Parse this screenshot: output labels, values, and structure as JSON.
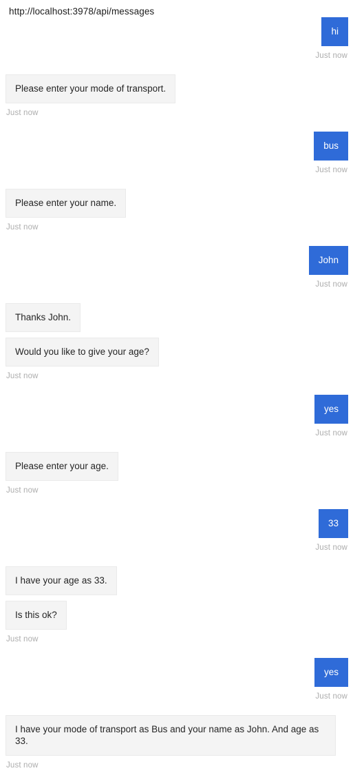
{
  "page": {
    "background_color": "#ffffff",
    "endpoint_url": "http://localhost:3978/api/messages"
  },
  "colors": {
    "user_bubble": "#2f6bd8",
    "user_text": "#ffffff",
    "bot_bubble": "#f4f4f4",
    "bot_border": "#eaeaea",
    "bot_text": "#252525",
    "timestamp": "#adadad"
  },
  "conversation": {
    "groups": [
      {
        "from": "user",
        "messages": [
          "hi"
        ],
        "timestamp": "Just now"
      },
      {
        "from": "bot",
        "messages": [
          "Please enter your mode of transport."
        ],
        "timestamp": "Just now"
      },
      {
        "from": "user",
        "messages": [
          "bus"
        ],
        "timestamp": "Just now"
      },
      {
        "from": "bot",
        "messages": [
          "Please enter your name."
        ],
        "timestamp": "Just now"
      },
      {
        "from": "user",
        "messages": [
          "John"
        ],
        "timestamp": "Just now"
      },
      {
        "from": "bot",
        "messages": [
          "Thanks John.",
          "Would you like to give your age?"
        ],
        "timestamp": "Just now"
      },
      {
        "from": "user",
        "messages": [
          "yes"
        ],
        "timestamp": "Just now"
      },
      {
        "from": "bot",
        "messages": [
          "Please enter your age."
        ],
        "timestamp": "Just now"
      },
      {
        "from": "user",
        "messages": [
          "33"
        ],
        "timestamp": "Just now"
      },
      {
        "from": "bot",
        "messages": [
          "I have your age as 33.",
          "Is this ok?"
        ],
        "timestamp": "Just now"
      },
      {
        "from": "user",
        "messages": [
          "yes"
        ],
        "timestamp": "Just now"
      },
      {
        "from": "bot",
        "messages": [
          "I have your mode of transport as Bus and your name as John. And age as 33."
        ],
        "timestamp": "Just now"
      }
    ]
  }
}
